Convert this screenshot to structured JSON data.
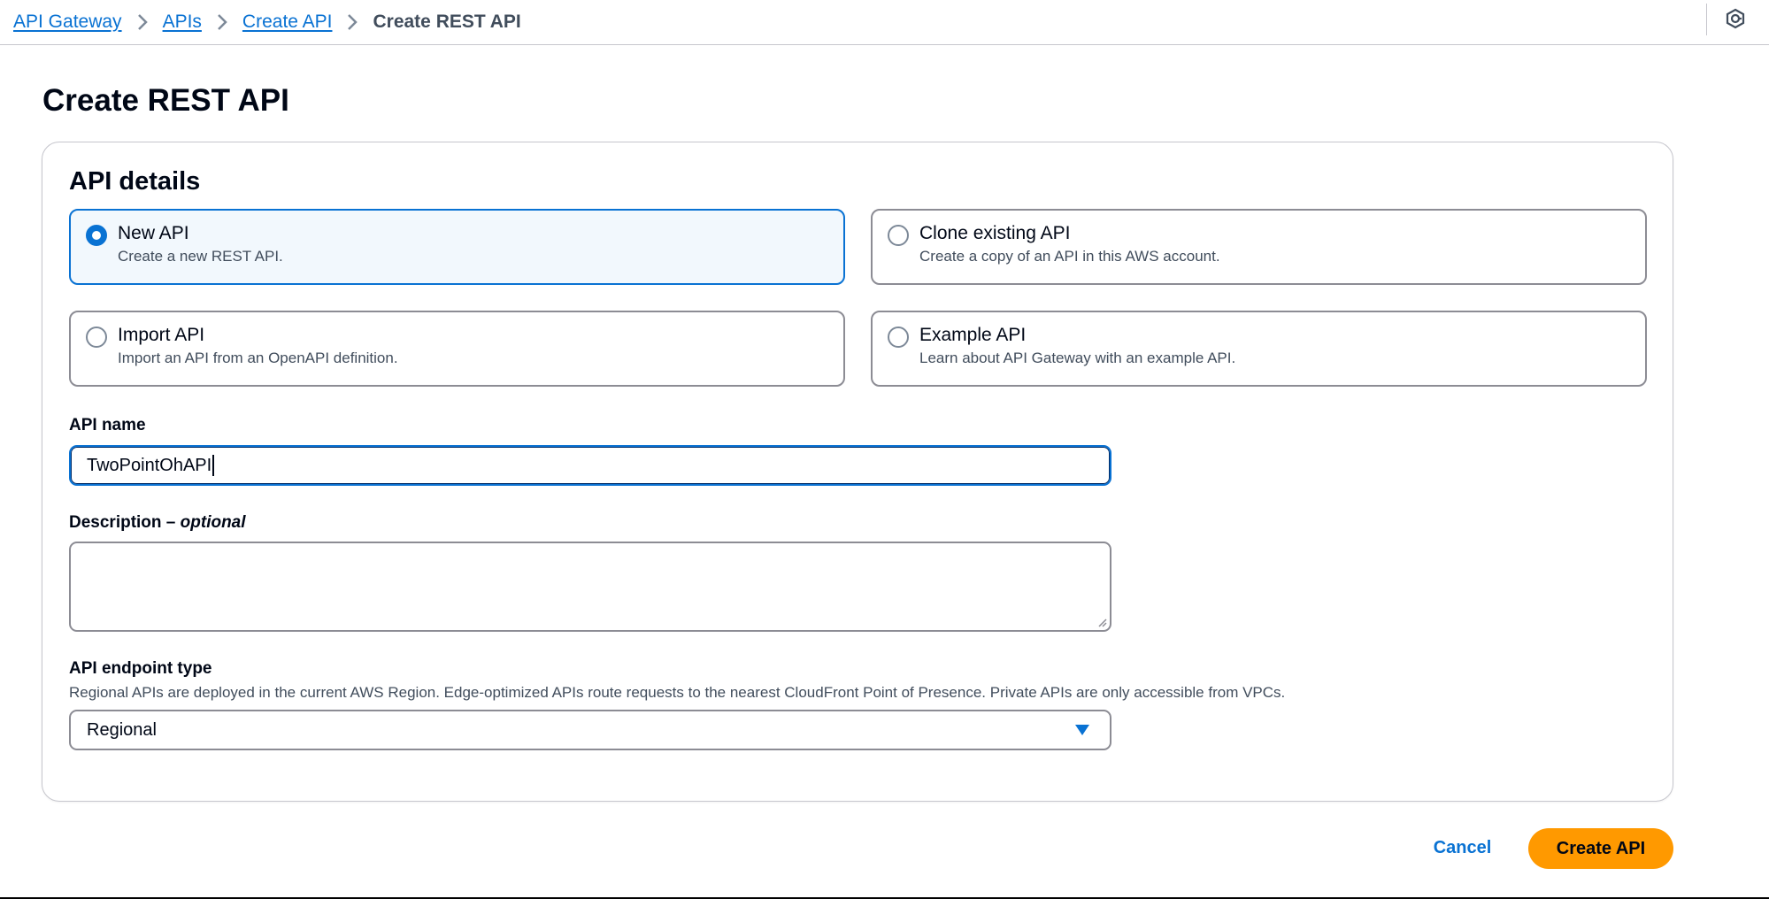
{
  "breadcrumb": {
    "items": [
      {
        "label": "API Gateway"
      },
      {
        "label": "APIs"
      },
      {
        "label": "Create API"
      }
    ],
    "current": "Create REST API"
  },
  "page": {
    "title": "Create REST API"
  },
  "api_details": {
    "title": "API details",
    "options": [
      {
        "label": "New API",
        "description": "Create a new REST API.",
        "selected": true
      },
      {
        "label": "Clone existing API",
        "description": "Create a copy of an API in this AWS account.",
        "selected": false
      },
      {
        "label": "Import API",
        "description": "Import an API from an OpenAPI definition.",
        "selected": false
      },
      {
        "label": "Example API",
        "description": "Learn about API Gateway with an example API.",
        "selected": false
      }
    ]
  },
  "api_name": {
    "label": "API name",
    "value": "TwoPointOhAPI"
  },
  "description": {
    "label": "Description",
    "optional_label": "optional",
    "value": ""
  },
  "endpoint_type": {
    "label": "API endpoint type",
    "help": "Regional APIs are deployed in the current AWS Region. Edge-optimized APIs route requests to the nearest CloudFront Point of Presence. Private APIs are only accessible from VPCs.",
    "selected": "Regional"
  },
  "actions": {
    "cancel": "Cancel",
    "create": "Create API"
  },
  "colors": {
    "link": "#0972d3",
    "primary_button": "#ff9900",
    "text": "#000716",
    "secondary_text": "#414d5c",
    "selected_tile_bg": "#f2f8fd"
  },
  "icons": {
    "breadcrumb_separator": "chevron-right-icon",
    "top_right": "cloudshell-icon",
    "select_caret": "caret-down-icon"
  }
}
